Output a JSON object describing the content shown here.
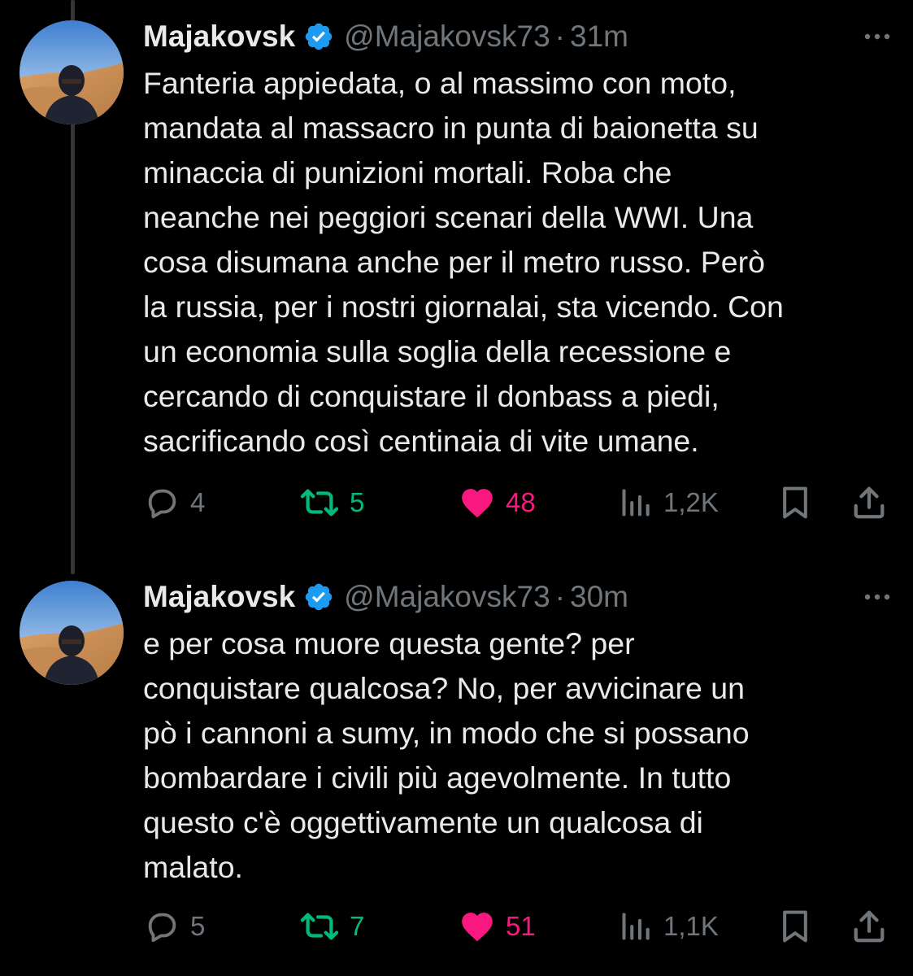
{
  "colors": {
    "background": "#000000",
    "text": "#e7e9ea",
    "muted": "#71767b",
    "verified": "#1d9bf0",
    "repost_active": "#00ba7c",
    "like_active": "#f91880"
  },
  "tweets": [
    {
      "name": "Majakovsk",
      "verified_icon": "verified-badge-icon",
      "handle": "@Majakovsk73",
      "separator": "·",
      "time": "31m",
      "more_icon": "more-options-icon",
      "text": "Fanteria appiedata, o al massimo con moto,\nmandata al massacro in punta di baionetta su\nminaccia di punizioni mortali. Roba che\nneanche nei peggiori scenari della WWI. Una\ncosa disumana anche per il metro russo. Però\nla russia, per i nostri giornalai, sta vicendo. Con\nun economia sulla soglia della recessione e\ncercando di conquistare il donbass a piedi,\nsacrificando così centinaia di vite umane.",
      "actions": {
        "replies": "4",
        "reposts": "5",
        "likes": "48",
        "views": "1,2K"
      }
    },
    {
      "name": "Majakovsk",
      "verified_icon": "verified-badge-icon",
      "handle": "@Majakovsk73",
      "separator": "·",
      "time": "30m",
      "more_icon": "more-options-icon",
      "text": "e per cosa muore questa gente? per\nconquistare qualcosa? No, per avvicinare un\npò i cannoni a sumy, in modo che si possano\nbombardare i civili più agevolmente. In tutto\nquesto c'è oggettivamente un qualcosa di\nmalato.",
      "actions": {
        "replies": "5",
        "reposts": "7",
        "likes": "51",
        "views": "1,1K"
      }
    }
  ]
}
